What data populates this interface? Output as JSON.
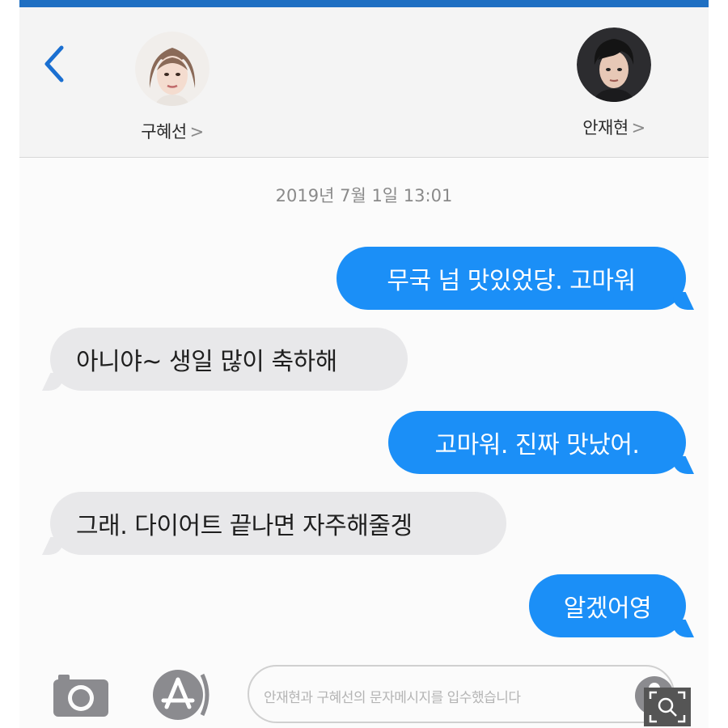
{
  "header": {
    "back_label": "<",
    "contacts": [
      {
        "name": "구혜선",
        "chevron": ">"
      },
      {
        "name": "안재현",
        "chevron": ">"
      }
    ]
  },
  "timestamp": "2019년 7월 1일  13:01",
  "messages": [
    {
      "direction": "outgoing",
      "text": "무국 넘 맛있었당. 고마워"
    },
    {
      "direction": "incoming",
      "text": "아니야~ 생일 많이 축하해"
    },
    {
      "direction": "outgoing",
      "text": "고마워. 진짜 맛났어."
    },
    {
      "direction": "incoming",
      "text": "그래. 다이어트 끝나면 자주해줄겡"
    },
    {
      "direction": "outgoing",
      "text": "알겠어영"
    }
  ],
  "composer": {
    "placeholder": "안재현과 구혜선의 문자메시지를 입수했습니다"
  },
  "icons": {
    "back": "chevron-left-icon",
    "camera": "camera-icon",
    "appstore": "app-store-icon",
    "mic": "microphone-icon",
    "zoom": "zoom-search-icon"
  },
  "colors": {
    "accent": "#1f6fc2",
    "outgoing_bubble": "#1b8ff7",
    "incoming_bubble": "#e8e8ea",
    "back_chevron": "#1a6fd1"
  }
}
